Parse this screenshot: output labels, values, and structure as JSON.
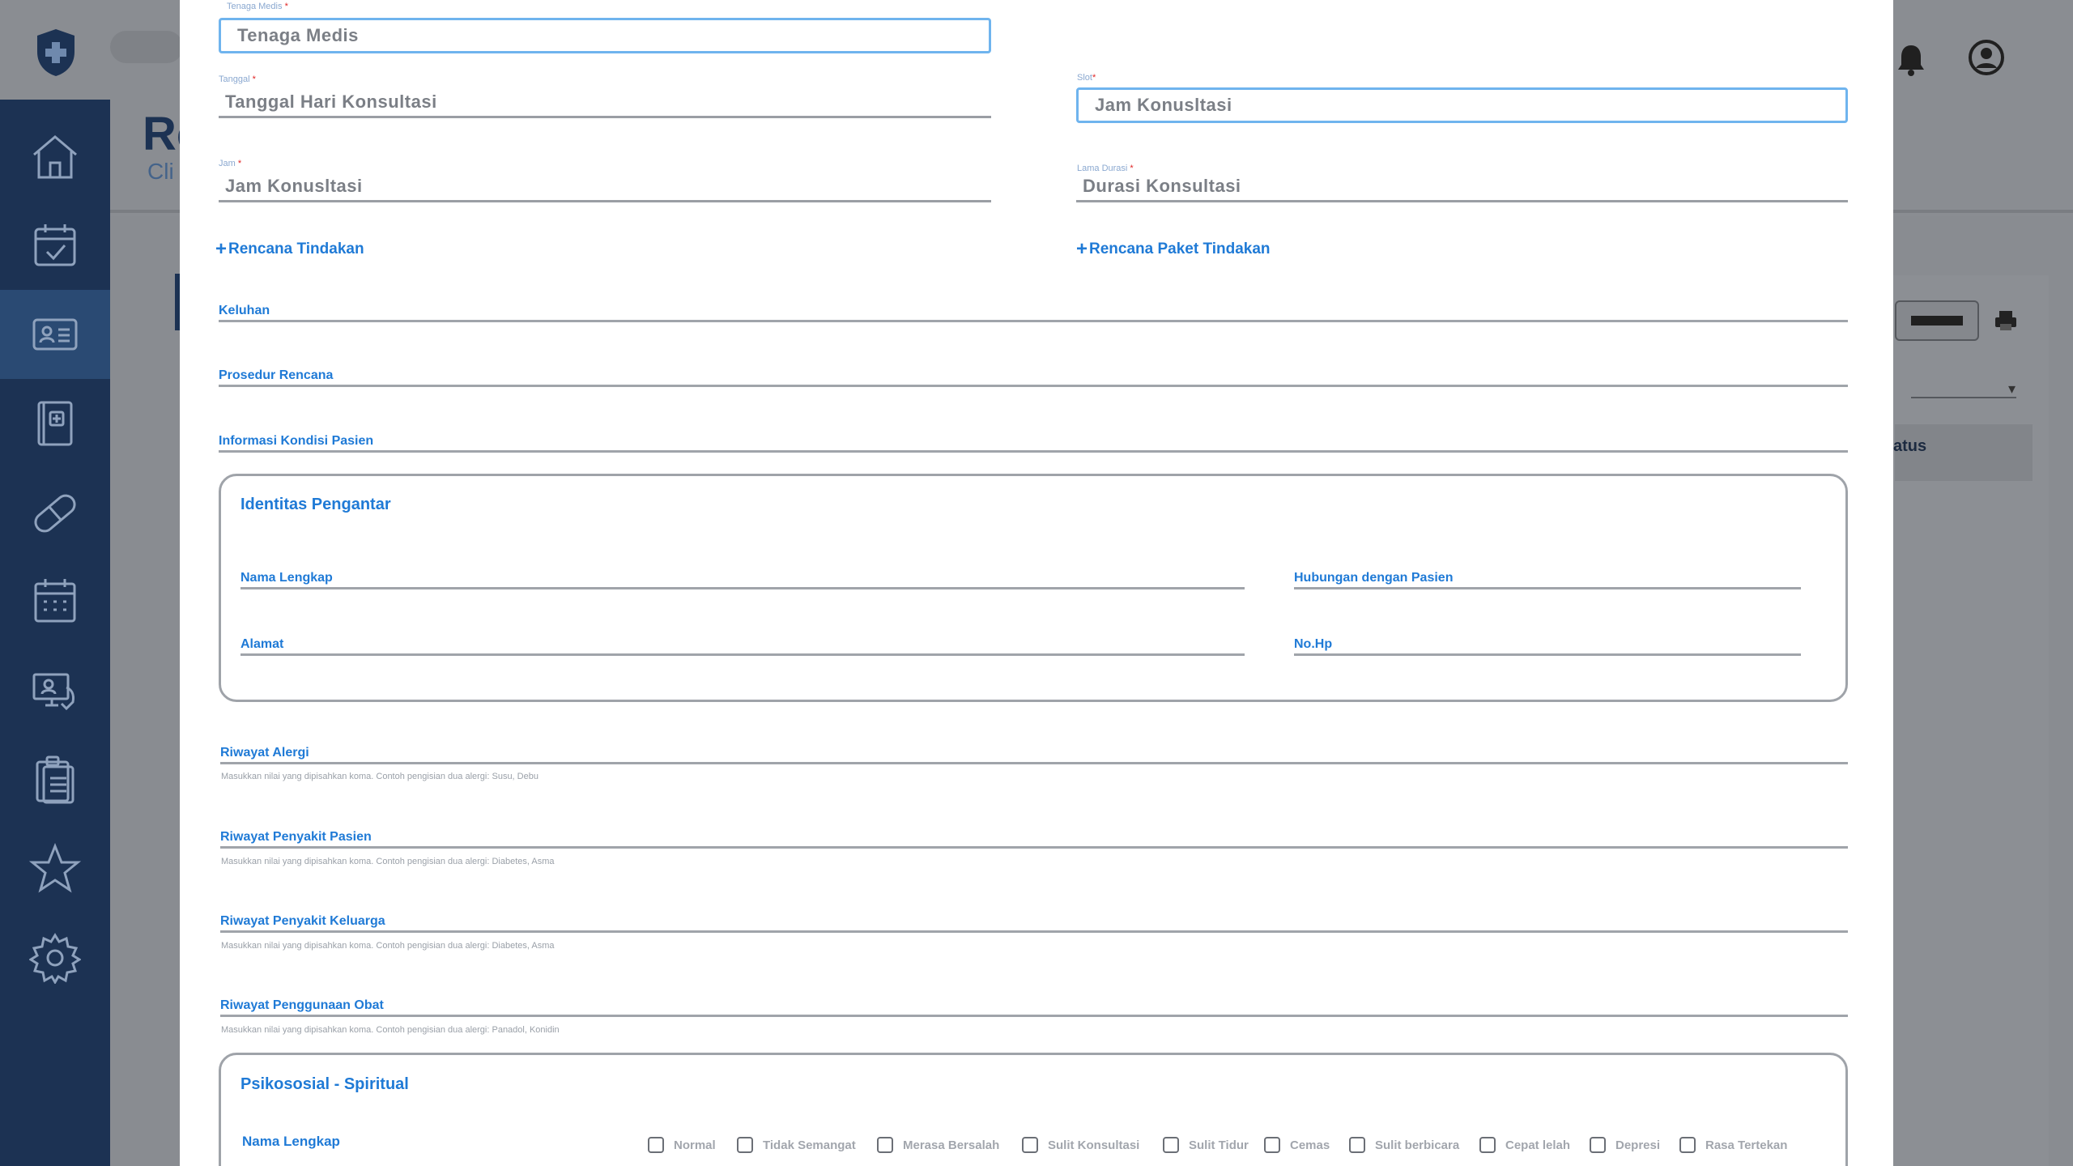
{
  "background": {
    "title_fragment": "Rc",
    "subtitle_fragment": "Cli",
    "status_fragment": "atus"
  },
  "icons": {
    "logo": "shield-plus-logo",
    "sidebar": [
      "home-icon",
      "calendar-check-icon",
      "id-card-icon",
      "medical-book-icon",
      "pill-icon",
      "calendar-grid-icon",
      "monitor-doctor-icon",
      "clipboard-icon",
      "star-icon",
      "gear-icon"
    ],
    "bell": "bell-icon",
    "user": "user-circle-icon",
    "print": "print-icon"
  },
  "colors": {
    "sidebar": "#1c3253",
    "accent_blue": "#1f7ad6",
    "input_border_focus": "#6fb4ee"
  },
  "form": {
    "tenaga_medis": {
      "label": "Tenaga Medis",
      "placeholder": "Tenaga Medis"
    },
    "tanggal": {
      "label": "Tanggal",
      "placeholder": "Tanggal Hari Konsultasi"
    },
    "slot": {
      "label": "Slot",
      "placeholder": "Jam Konusltasi"
    },
    "jam": {
      "label": "Jam",
      "placeholder": "Jam Konusltasi"
    },
    "lama_durasi": {
      "label": "Lama Durasi",
      "placeholder": "Durasi Konsultasi"
    },
    "rencana_tindakan": "Rencana Tindakan",
    "rencana_paket_tindakan": "Rencana Paket Tindakan",
    "keluhan": "Keluhan",
    "prosedur_rencana": "Prosedur Rencana",
    "informasi_kondisi_pasien": "Informasi Kondisi Pasien",
    "identitas_pengantar": {
      "title": "Identitas Pengantar",
      "nama_lengkap": "Nama Lengkap",
      "hubungan": "Hubungan dengan Pasien",
      "alamat": "Alamat",
      "nohp": "No.Hp"
    },
    "riwayat_alergi": {
      "label": "Riwayat Alergi",
      "hint": "Masukkan nilai yang dipisahkan koma. Contoh pengisian dua alergi: Susu, Debu"
    },
    "riwayat_penyakit_pasien": {
      "label": "Riwayat Penyakit Pasien",
      "hint": "Masukkan nilai yang dipisahkan koma. Contoh pengisian dua alergi: Diabetes, Asma"
    },
    "riwayat_penyakit_keluarga": {
      "label": "Riwayat Penyakit Keluarga",
      "hint": "Masukkan nilai yang dipisahkan koma. Contoh pengisian dua alergi: Diabetes, Asma"
    },
    "riwayat_penggunaan_obat": {
      "label": "Riwayat Penggunaan Obat",
      "hint": "Masukkan nilai yang dipisahkan koma. Contoh pengisian dua alergi: Panadol, Konidin"
    },
    "psikososial": {
      "title": "Psikososial - Spiritual",
      "nama_lengkap": "Nama Lengkap",
      "options": [
        "Normal",
        "Tidak Semangat",
        "Merasa Bersalah",
        "Sulit Konsultasi",
        "Sulit Tidur",
        "Cemas",
        "Sulit berbicara",
        "Cepat lelah",
        "Depresi",
        "Rasa Tertekan"
      ]
    }
  }
}
